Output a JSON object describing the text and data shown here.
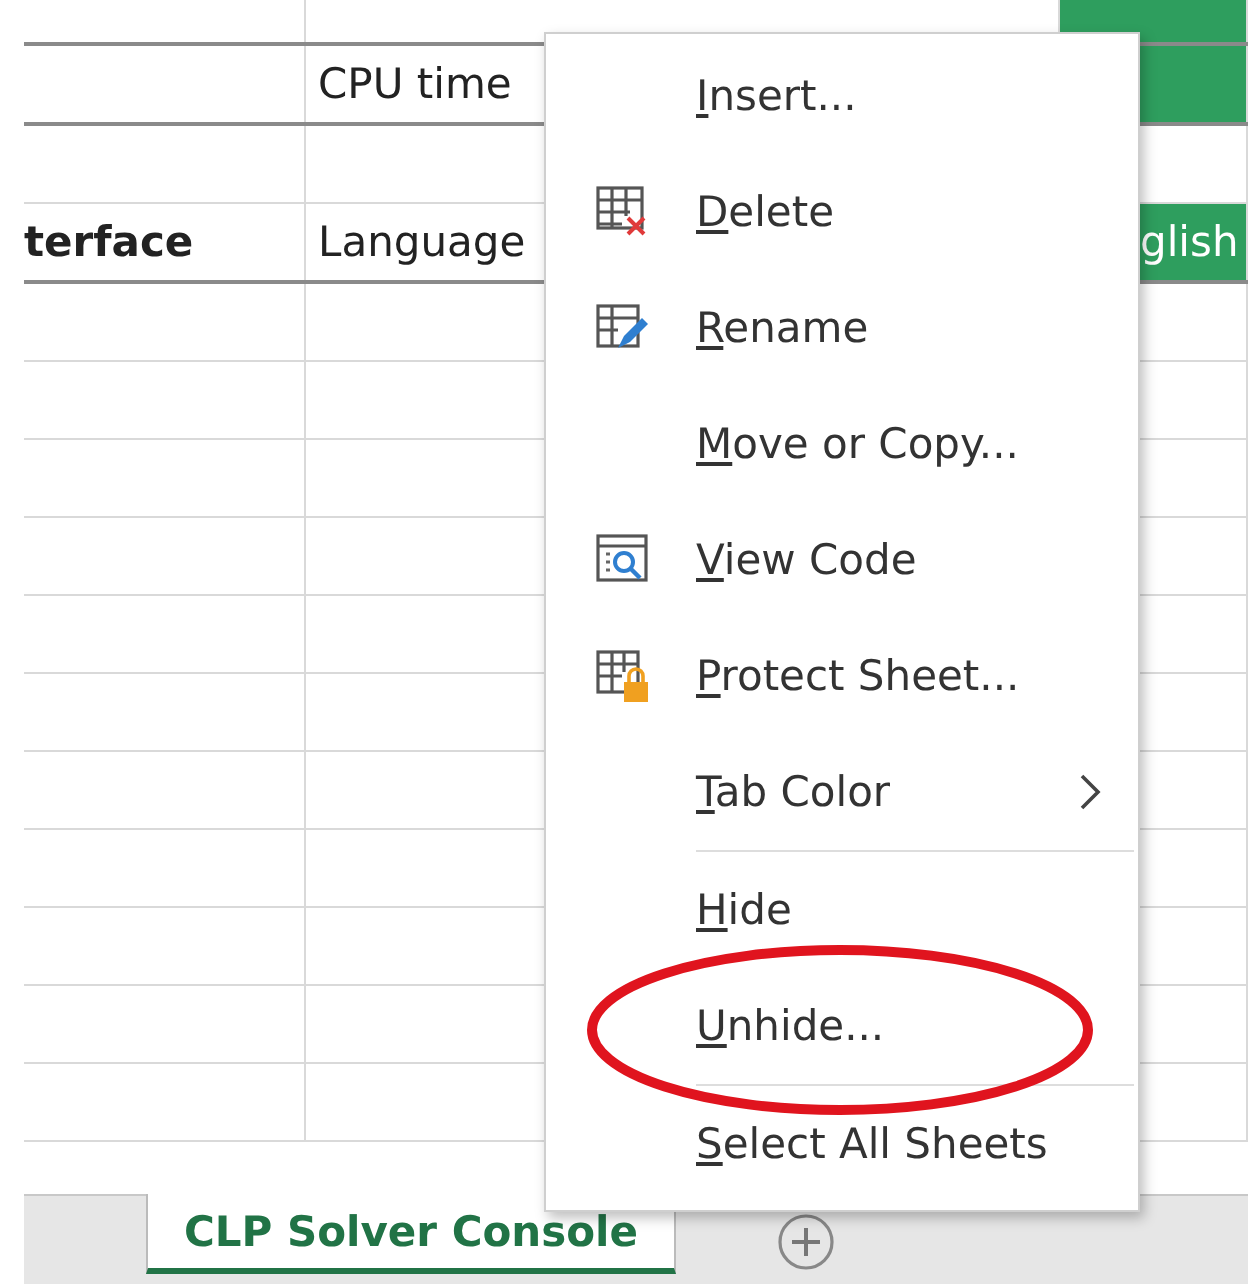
{
  "sheet": {
    "rows": [
      {
        "cells": [
          {},
          {},
          {
            "color": "#2e9e5e"
          }
        ],
        "strong_border": true
      },
      {
        "cells": [
          {},
          {
            "text": "CPU time"
          },
          {
            "color": "#2e9e5e"
          }
        ],
        "strong_border": true
      },
      {
        "cells": [
          {},
          {},
          {}
        ],
        "strong_border": false
      },
      {
        "cells": [
          {
            "text": "terface",
            "bold": true
          },
          {
            "text": "Language"
          },
          {
            "text": "glish",
            "color": "#2e9e5e"
          }
        ],
        "strong_border": true
      },
      {
        "cells": [
          {},
          {},
          {}
        ],
        "strong_border": false
      },
      {
        "cells": [
          {},
          {},
          {}
        ],
        "strong_border": false
      },
      {
        "cells": [
          {},
          {},
          {}
        ],
        "strong_border": false
      },
      {
        "cells": [
          {},
          {},
          {}
        ],
        "strong_border": false
      },
      {
        "cells": [
          {},
          {},
          {}
        ],
        "strong_border": false
      },
      {
        "cells": [
          {},
          {},
          {}
        ],
        "strong_border": false
      },
      {
        "cells": [
          {},
          {},
          {}
        ],
        "strong_border": false
      },
      {
        "cells": [
          {},
          {},
          {}
        ],
        "strong_border": false
      },
      {
        "cells": [
          {},
          {},
          {}
        ],
        "strong_border": false
      },
      {
        "cells": [
          {},
          {},
          {}
        ],
        "strong_border": false
      },
      {
        "cells": [
          {},
          {},
          {}
        ],
        "strong_border": false
      }
    ]
  },
  "sheet_tabs": [
    {
      "label": "CLP Solver Console",
      "selected": true
    }
  ],
  "context_menu": {
    "items": [
      {
        "kind": "item",
        "mnemonic": "I",
        "rest": "nsert...",
        "has_submenu": false,
        "circled": false
      },
      {
        "kind": "item",
        "mnemonic": "D",
        "rest": "elete",
        "has_submenu": false,
        "circled": false
      },
      {
        "kind": "item",
        "mnemonic": "R",
        "rest": "ename",
        "has_submenu": false,
        "circled": false
      },
      {
        "kind": "item",
        "mnemonic": "M",
        "rest": "ove or Copy...",
        "has_submenu": false,
        "circled": false
      },
      {
        "kind": "item",
        "mnemonic": "V",
        "rest": "iew Code",
        "has_submenu": false,
        "circled": false
      },
      {
        "kind": "item",
        "mnemonic": "P",
        "rest": "rotect Sheet...",
        "has_submenu": false,
        "circled": false
      },
      {
        "kind": "item",
        "mnemonic": "T",
        "rest": "ab Color",
        "has_submenu": true,
        "circled": false
      },
      {
        "kind": "separator"
      },
      {
        "kind": "item",
        "mnemonic": "H",
        "rest": "ide",
        "has_submenu": false,
        "circled": false
      },
      {
        "kind": "item",
        "mnemonic": "U",
        "rest": "nhide...",
        "has_submenu": false,
        "circled": true
      },
      {
        "kind": "separator"
      },
      {
        "kind": "item",
        "mnemonic": "S",
        "rest": "elect All Sheets",
        "has_submenu": false,
        "circled": false
      }
    ]
  }
}
